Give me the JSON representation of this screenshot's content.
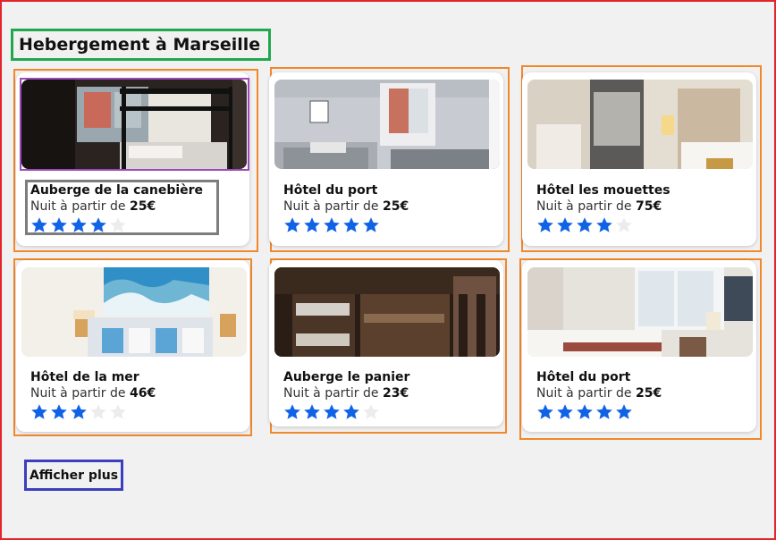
{
  "page": {
    "title": "Hebergement à Marseille",
    "price_prefix": "Nuit à partir de",
    "more_label": "Afficher plus"
  },
  "colors": {
    "star_on": "#1163e6",
    "star_off": "#ececec"
  },
  "hotels": [
    {
      "name": "Auberge de la canebière",
      "price": "25€",
      "rating": 4
    },
    {
      "name": "Hôtel du port",
      "price": "25€",
      "rating": 5
    },
    {
      "name": "Hôtel les mouettes",
      "price": "75€",
      "rating": 4
    },
    {
      "name": "Hôtel de la mer",
      "price": "46€",
      "rating": 3
    },
    {
      "name": "Auberge le panier",
      "price": "23€",
      "rating": 4
    },
    {
      "name": "Hôtel du port",
      "price": "25€",
      "rating": 5
    }
  ]
}
